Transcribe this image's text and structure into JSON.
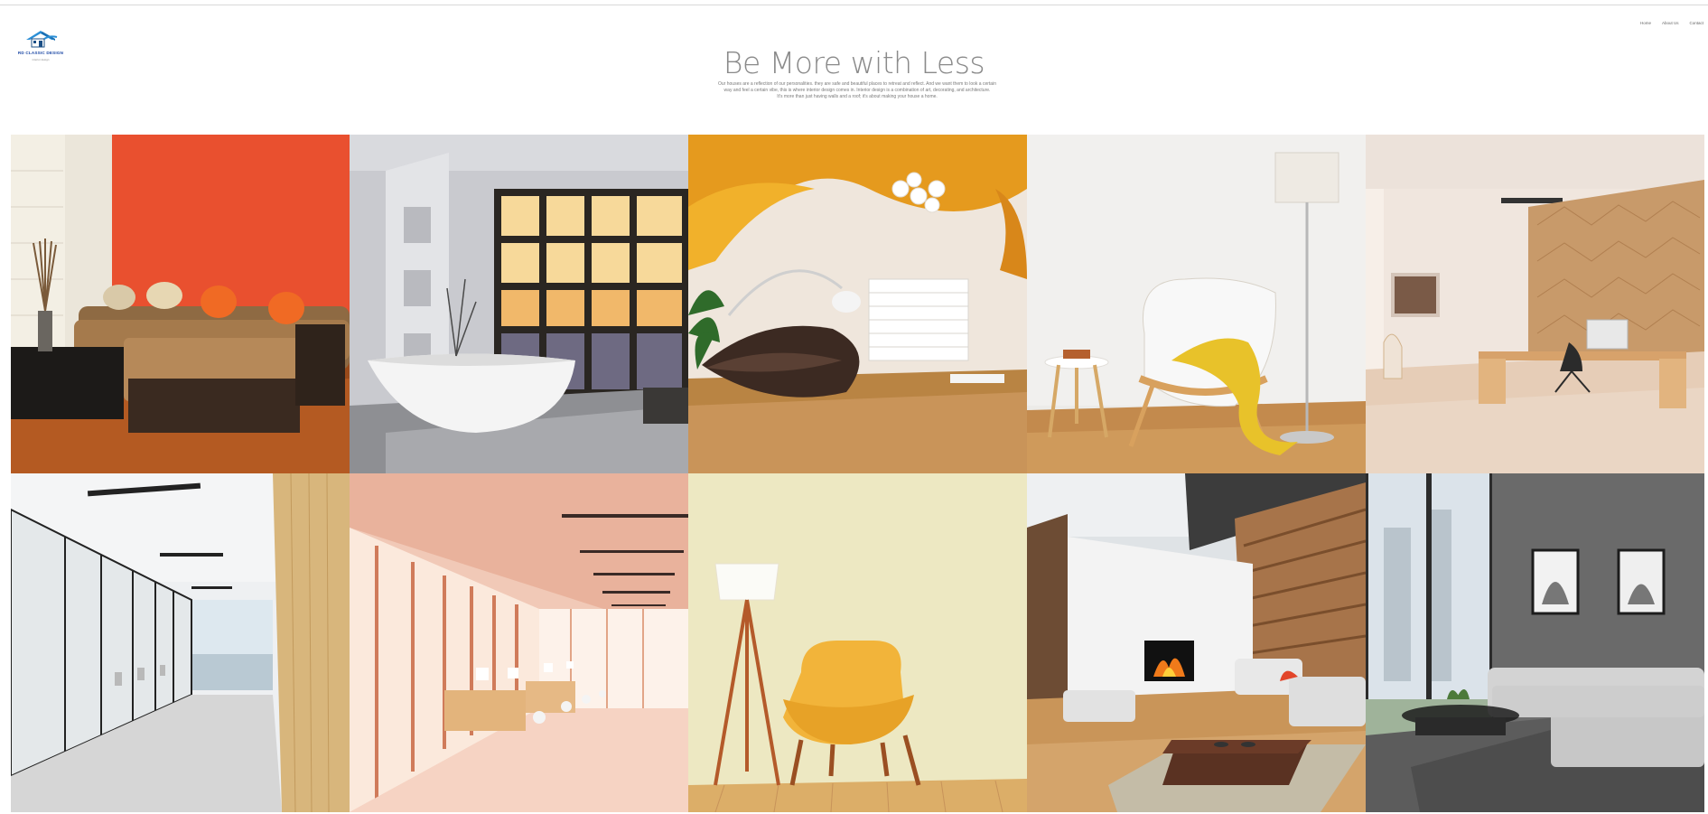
{
  "brand": {
    "name": "RD CLASSIC DESIGN",
    "tagline": "interior design"
  },
  "nav": {
    "items": [
      "Home",
      "About Us",
      "Contact"
    ]
  },
  "hero": {
    "title": "Be More with Less",
    "description_lines": [
      "Our houses are a reflection of our personalities. they are safe and beautiful places to retreat and reflect. And we want them to look a certain",
      "way and feel a certain vibe, this is where interior design comes in. Interior design is a combination of art, decorating, and architecture.",
      "It's more than just having walls and a roof; it's about making your house a home."
    ]
  },
  "gallery": {
    "items": [
      {
        "name": "living-room-orange-wall-photo"
      },
      {
        "name": "white-bathroom-bathtub-photo"
      },
      {
        "name": "orange-ceiling-lounge-photo"
      },
      {
        "name": "white-armchair-floor-lamp-photo"
      },
      {
        "name": "wood-panel-home-office-photo"
      },
      {
        "name": "glass-office-corridor-photo"
      },
      {
        "name": "pink-open-office-photo"
      },
      {
        "name": "yellow-armchair-lamp-photo"
      },
      {
        "name": "fireplace-living-room-photo"
      },
      {
        "name": "gray-sofa-living-room-photo"
      }
    ]
  },
  "colors": {
    "brand_blue": "#1d49a6",
    "logo_roof": "#2b8fd6"
  }
}
